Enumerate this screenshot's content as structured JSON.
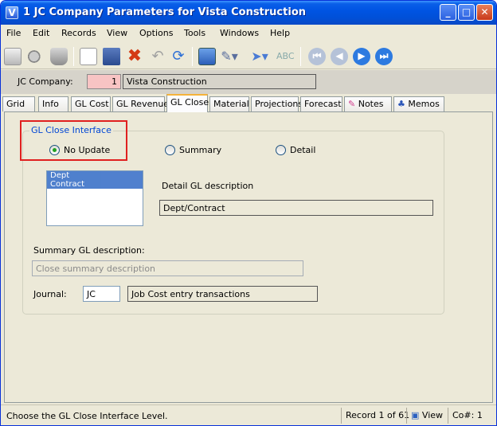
{
  "window": {
    "title": "1 JC Company Parameters for Vista Construction",
    "app_icon_letter": "V",
    "controls": {
      "minimize": "_",
      "maximize": "□",
      "close": "✕"
    }
  },
  "menu": [
    {
      "label": "File"
    },
    {
      "label": "Edit"
    },
    {
      "label": "Records"
    },
    {
      "label": "View"
    },
    {
      "label": "Options"
    },
    {
      "label": "Tools"
    },
    {
      "label": "Windows"
    },
    {
      "label": "Help"
    }
  ],
  "company": {
    "label": "JC Company:",
    "number": "1",
    "name": "Vista Construction"
  },
  "tabs": [
    "Grid",
    "Info",
    "GL Cost",
    "GL Revenue",
    "GL Close",
    "Material",
    "Projections",
    "Forecast",
    "Notes",
    "Memos"
  ],
  "gl_close": {
    "group_title": "GL Close Interface",
    "options": [
      "No Update",
      "Summary",
      "Detail"
    ],
    "selected": "No Update",
    "list_items": [
      "Dept",
      "Contract"
    ],
    "detail_label": "Detail GL description",
    "detail_value": "Dept/Contract",
    "summary_label": "Summary GL description:",
    "summary_placeholder": "Close summary description",
    "journal_label": "Journal:",
    "journal_code": "JC",
    "journal_desc": "Job Cost entry transactions"
  },
  "status": {
    "message": "Choose the GL Close Interface Level.",
    "record": "Record 1 of 61",
    "view": "View",
    "company": "Co#: 1"
  },
  "colors": {
    "titlebar": "#0054e3",
    "highlight_box": "#e02020",
    "company_number_bg": "#f8c4c4",
    "group_title": "#0046d5",
    "active_tab_accent": "#f5b33a"
  }
}
